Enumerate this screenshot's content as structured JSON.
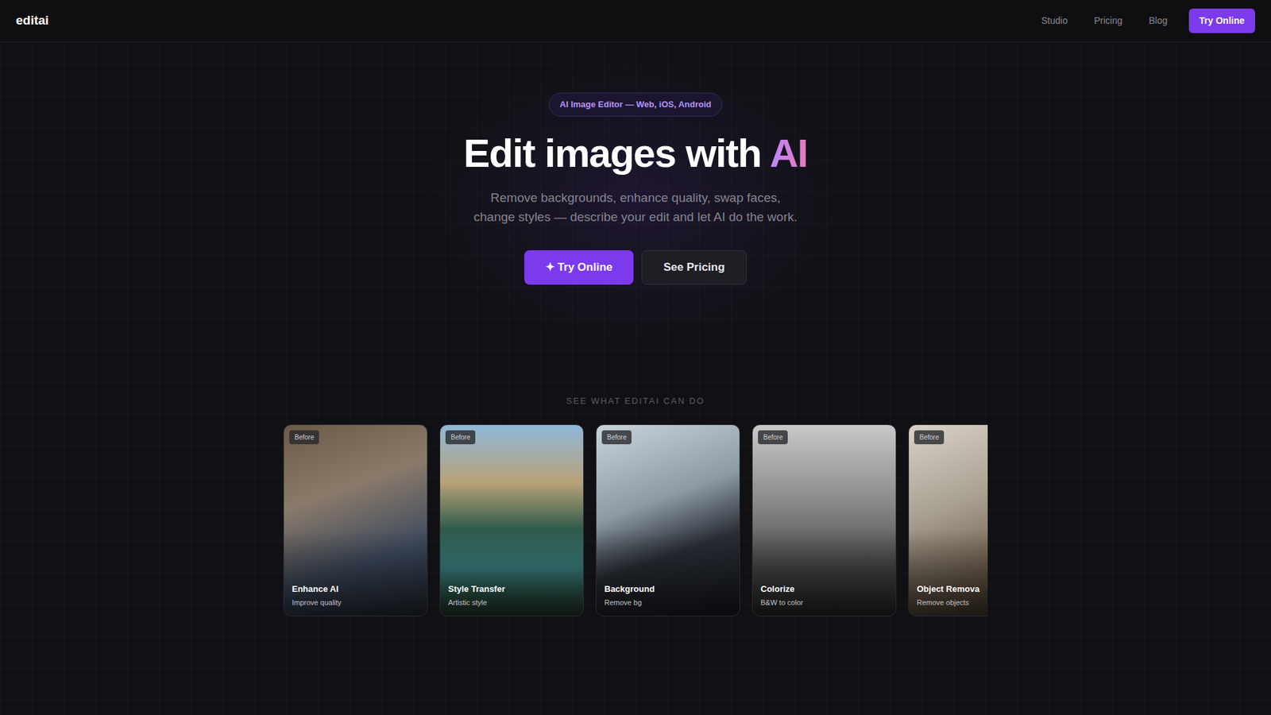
{
  "nav": {
    "logo": "editai",
    "links": [
      "Studio",
      "Pricing",
      "Blog"
    ],
    "cta": "Try Online"
  },
  "hero": {
    "badge": "AI Image Editor — Web, iOS, Android",
    "title": "Edit images with",
    "title_highlight": "AI",
    "subtitle": "Remove backgrounds, enhance quality, swap faces, change styles — describe your edit and let AI do the work.",
    "primary_button": {
      "icon": "✦",
      "label": "Try Online"
    },
    "secondary_button": "See Pricing"
  },
  "showcase": {
    "label": "SEE WHAT EDITAI CAN DO",
    "cards": [
      {
        "badge": "Before",
        "title": "Enhance AI",
        "subtitle": "Improve quality"
      },
      {
        "badge": "Before",
        "title": "Style Transfer",
        "subtitle": "Artistic style"
      },
      {
        "badge": "Before",
        "title": "Background",
        "subtitle": "Remove bg"
      },
      {
        "badge": "Before",
        "title": "Colorize",
        "subtitle": "B&W to color"
      },
      {
        "badge": "Before",
        "title": "Object Remova",
        "subtitle": "Remove objects"
      }
    ]
  }
}
